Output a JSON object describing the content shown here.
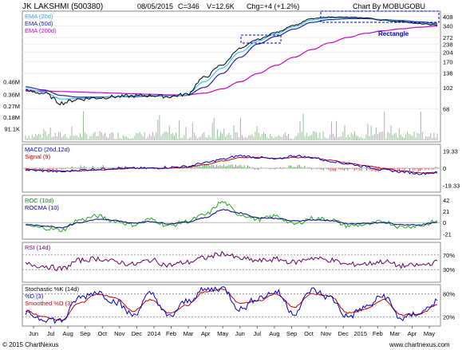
{
  "header": {
    "symbol": "JK LAKSHMI (500380)",
    "date": "08/05/2015",
    "close": "C=346",
    "volume": "V=12.6K",
    "change": "Chg=+4 (+1.2%)",
    "author": "Chart By MOBUGOBU"
  },
  "footer": {
    "copyright": "© 2015 ChartNexus",
    "website": "www.chartnexus.com"
  },
  "colors": {
    "price": "#000000",
    "ema20": "#33ccff",
    "ema50": "#2222aa",
    "ema200": "#cc00cc",
    "volume": "#99bb99",
    "macd": "#0000cc",
    "signal": "#cc0000",
    "roc": "#22aa22",
    "rocma": "#000088",
    "rsi": "#660066",
    "stoch_k": "#0000cc",
    "stoch_d": "#cc0000",
    "annotation": "#0000cc"
  },
  "chart_data": [
    {
      "panel": "price",
      "type": "line",
      "legend": [
        "EMA (20d)",
        "EMA (50d)",
        "EMA (200d)"
      ],
      "x_ticks": [
        "Jun",
        "Jul",
        "Aug",
        "Sep",
        "Oct",
        "Nov",
        "Dec",
        "2014",
        "Feb",
        "Mar",
        "Apr",
        "May",
        "Jun",
        "Jul",
        "Aug",
        "Sep",
        "Oct",
        "Nov",
        "Dec",
        "2015",
        "Feb",
        "Mar",
        "Apr",
        "May"
      ],
      "y_ticks": [
        "408",
        "340",
        "272",
        "238",
        "204",
        "170",
        "136",
        "102",
        "68"
      ],
      "yscale": "log",
      "ylim": [
        55,
        440
      ],
      "series": [
        {
          "name": "Price",
          "values": [
            96,
            92,
            76,
            82,
            84,
            86,
            87,
            88,
            86,
            90,
            125,
            160,
            220,
            262,
            300,
            345,
            392,
            405,
            402,
            398,
            380,
            370,
            355,
            346
          ]
        },
        {
          "name": "EMA (20d)",
          "values": [
            100,
            94,
            82,
            83,
            84,
            86,
            87,
            88,
            87,
            89,
            115,
            150,
            205,
            255,
            292,
            335,
            382,
            398,
            400,
            397,
            383,
            372,
            360,
            350
          ]
        },
        {
          "name": "EMA (50d)",
          "values": [
            104,
            98,
            88,
            85,
            85,
            86,
            86,
            87,
            87,
            88,
            103,
            135,
            185,
            240,
            278,
            320,
            365,
            385,
            392,
            392,
            385,
            378,
            368,
            358
          ]
        },
        {
          "name": "EMA (200d)",
          "values": [
            96,
            96,
            95,
            94,
            93,
            92,
            91,
            90,
            89,
            89,
            92,
            100,
            115,
            135,
            158,
            185,
            215,
            245,
            272,
            295,
            310,
            322,
            332,
            340
          ]
        }
      ],
      "annotations": [
        "Rectangle"
      ]
    },
    {
      "panel": "volume",
      "type": "bar",
      "y_ticks": [
        "0.46M",
        "0.36M",
        "0.27M",
        "0.18M",
        "91.1K"
      ],
      "ylim": [
        0,
        0.5
      ]
    },
    {
      "panel": "macd",
      "type": "line",
      "legend": [
        "MACD (26d,12d)",
        "Signal (9)"
      ],
      "y_ticks": [
        "19.33",
        "0",
        "-19.33"
      ],
      "ylim": [
        -25,
        25
      ],
      "series": [
        {
          "name": "MACD (26d,12d)",
          "values": [
            -2,
            -3,
            -4,
            -2,
            -1,
            0,
            0,
            0,
            1,
            2,
            6,
            10,
            14,
            12,
            10,
            14,
            12,
            8,
            5,
            2,
            -2,
            -4,
            -6,
            -5
          ]
        },
        {
          "name": "Signal (9)",
          "values": [
            -1,
            -2,
            -3,
            -3,
            -2,
            -1,
            0,
            0,
            0,
            1,
            4,
            8,
            12,
            12,
            11,
            12,
            12,
            9,
            6,
            3,
            0,
            -3,
            -5,
            -5
          ]
        }
      ]
    },
    {
      "panel": "roc",
      "type": "line",
      "legend": [
        "ROC (10d)",
        "ROCMA (10)"
      ],
      "y_ticks": [
        "42",
        "21",
        "0",
        "-21"
      ],
      "ylim": [
        -28,
        48
      ],
      "series": [
        {
          "name": "ROC (10d)",
          "values": [
            -6,
            -10,
            -14,
            5,
            12,
            3,
            -4,
            6,
            -6,
            2,
            14,
            38,
            15,
            6,
            12,
            -3,
            8,
            6,
            -6,
            -4,
            2,
            -8,
            -6,
            2
          ]
        },
        {
          "name": "ROCMA (10)",
          "values": [
            -4,
            -6,
            -9,
            0,
            6,
            4,
            -1,
            2,
            -2,
            1,
            9,
            24,
            18,
            9,
            8,
            3,
            5,
            4,
            -2,
            -2,
            0,
            -4,
            -4,
            0
          ]
        }
      ]
    },
    {
      "panel": "rsi",
      "type": "line",
      "legend": [
        "RSI (14d)"
      ],
      "y_ticks": [
        "70%",
        "30%"
      ],
      "ylim": [
        0,
        100
      ],
      "series": [
        {
          "name": "RSI (14d)",
          "values": [
            45,
            40,
            32,
            55,
            60,
            52,
            44,
            56,
            42,
            50,
            62,
            74,
            60,
            54,
            58,
            50,
            62,
            56,
            44,
            46,
            52,
            40,
            42,
            50
          ]
        }
      ]
    },
    {
      "panel": "stochastic",
      "type": "line",
      "legend": [
        "Stochastic %K (14d)",
        "%D (3)",
        "Smoothed %D (3)"
      ],
      "y_ticks": [
        "80%",
        "20%"
      ],
      "ylim": [
        0,
        100
      ],
      "series": [
        {
          "name": "%D (3)",
          "values": [
            30,
            15,
            10,
            70,
            85,
            60,
            25,
            80,
            20,
            60,
            90,
            95,
            40,
            70,
            85,
            30,
            90,
            70,
            20,
            45,
            75,
            15,
            30,
            60
          ]
        },
        {
          "name": "Smoothed %D (3)",
          "values": [
            35,
            20,
            12,
            55,
            80,
            70,
            35,
            65,
            30,
            50,
            85,
            92,
            55,
            62,
            80,
            45,
            80,
            75,
            30,
            40,
            65,
            25,
            28,
            50
          ]
        }
      ]
    }
  ]
}
